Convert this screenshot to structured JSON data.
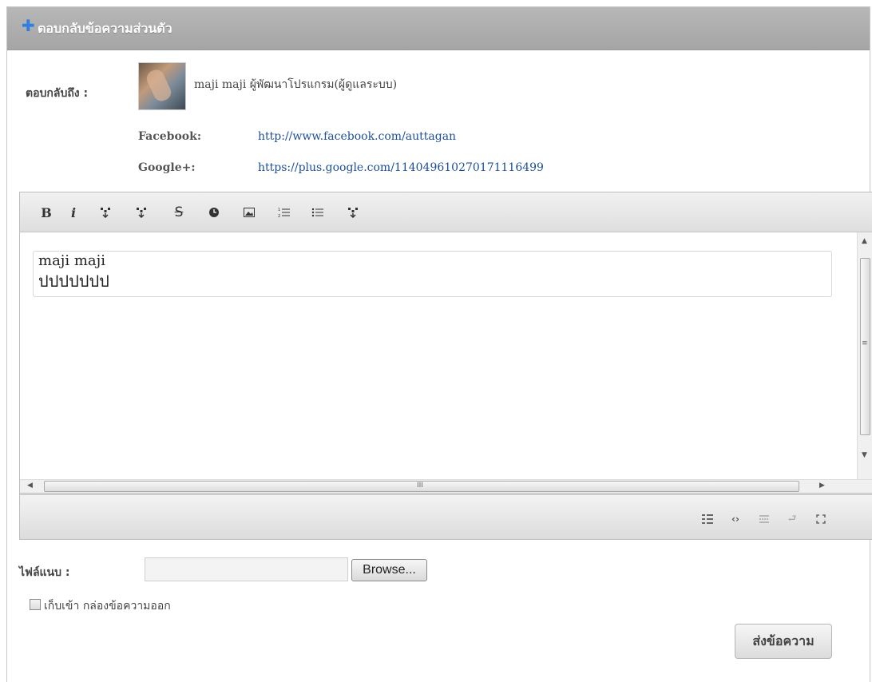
{
  "header": {
    "title": "ตอบกลับข้อความส่วนตัว"
  },
  "recipient": {
    "label": "ตอบกลับถึง :",
    "name": "maji maji ผู้พัฒนาโปรแกรม(ผู้ดูแลระบบ)",
    "facebook_label": "Facebook:",
    "facebook_url": "http://www.facebook.com/auttagan",
    "google_label": "Google+:",
    "google_url": "https://plus.google.com/114049610270171116499"
  },
  "editor": {
    "toolbar": [
      "bold",
      "italic",
      "format-a",
      "format-b",
      "strikethrough",
      "color",
      "image",
      "ordered-list",
      "unordered-list",
      "format-c"
    ],
    "content_line1": "maji maji",
    "content_line2": "ปปปปปปป",
    "hscroll_grip": "III",
    "vscroll_grip": "≡",
    "bottom_tools": [
      "grid-icon",
      "code-icon",
      "split-icon",
      "wrap-icon",
      "fullscreen-icon"
    ]
  },
  "attachment": {
    "label": "ไฟล์แนบ :",
    "browse_label": "Browse..."
  },
  "save_copy": {
    "label": "เก็บเข้า กล่องข้อความออก",
    "checked": false
  },
  "send_label": "ส่งข้อความ",
  "colors": {
    "header_bg": "#adadad",
    "link": "#1d4f99",
    "plus": "#2f7fe0"
  }
}
